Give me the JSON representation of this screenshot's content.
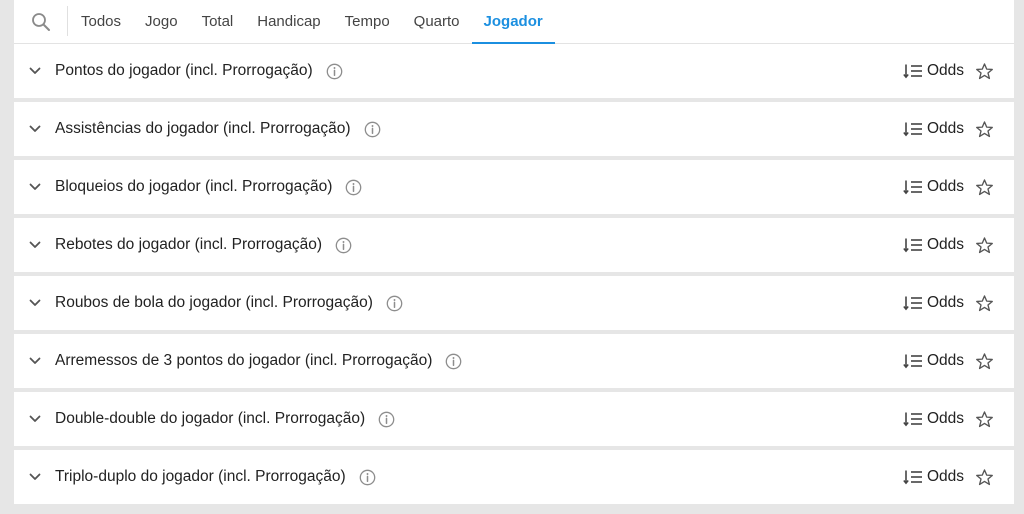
{
  "tabs": [
    {
      "label": "Todos",
      "active": false
    },
    {
      "label": "Jogo",
      "active": false
    },
    {
      "label": "Total",
      "active": false
    },
    {
      "label": "Handicap",
      "active": false
    },
    {
      "label": "Tempo",
      "active": false
    },
    {
      "label": "Quarto",
      "active": false
    },
    {
      "label": "Jogador",
      "active": true
    }
  ],
  "search": {
    "icon": "search-icon"
  },
  "markets": [
    {
      "title": "Pontos do jogador (incl. Prorrogação)",
      "odds_label": "Odds"
    },
    {
      "title": "Assistências do jogador (incl. Prorrogação)",
      "odds_label": "Odds"
    },
    {
      "title": "Bloqueios do jogador (incl. Prorrogação)",
      "odds_label": "Odds"
    },
    {
      "title": "Rebotes do jogador (incl. Prorrogação)",
      "odds_label": "Odds"
    },
    {
      "title": "Roubos de bola do jogador (incl. Prorrogação)",
      "odds_label": "Odds"
    },
    {
      "title": "Arremessos de 3 pontos do jogador (incl. Prorrogação)",
      "odds_label": "Odds"
    },
    {
      "title": "Double-double do jogador (incl. Prorrogação)",
      "odds_label": "Odds"
    },
    {
      "title": "Triplo-duplo do jogador (incl. Prorrogação)",
      "odds_label": "Odds"
    }
  ],
  "colors": {
    "accent": "#1b8fe0",
    "background": "#e6e6e6",
    "row": "#ffffff",
    "text": "#222222",
    "icon": "#777777"
  }
}
